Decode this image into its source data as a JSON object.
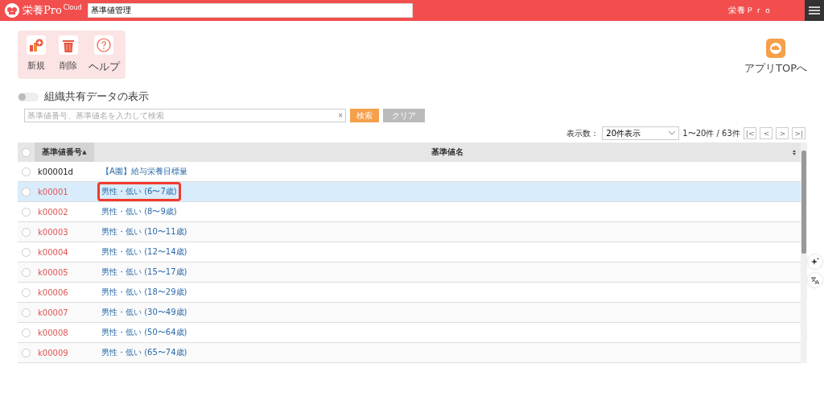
{
  "header": {
    "logo_text": "栄養Pro",
    "logo_badge": "Cloud",
    "page_field": "基準値管理",
    "app_name": "栄養Ｐｒｏ"
  },
  "toolbar": [
    {
      "kind": "new",
      "label": "新規"
    },
    {
      "kind": "delete",
      "label": "削除"
    },
    {
      "kind": "help",
      "label": "ヘルプ"
    }
  ],
  "app_top": {
    "label": "アプリTOPへ"
  },
  "shared_toggle": {
    "label": "組織共有データの表示",
    "on": false
  },
  "search": {
    "placeholder": "基準値番号、基準値名を入力して検索",
    "clear_glyph": "×",
    "search_button": "検索",
    "clear_button": "クリア"
  },
  "pagination": {
    "label": "表示数：",
    "page_size": "20件表示",
    "range": "1〜20件 / 63件",
    "buttons": [
      "|<",
      "<",
      ">",
      ">|"
    ]
  },
  "table": {
    "select_all_checked": false,
    "columns": [
      {
        "label": "基準値番号",
        "sort_glyph": "▲",
        "selected": true
      },
      {
        "label": "基準値名",
        "selected": false
      }
    ],
    "rows": [
      {
        "code": "k00001d",
        "name": "【A園】給与栄養目標量",
        "color": "#222222",
        "selected": false,
        "outlined": false
      },
      {
        "code": "k00001",
        "name": "男性・低い (6〜7歳)",
        "color": "#e05555",
        "selected": true,
        "outlined": true
      },
      {
        "code": "k00002",
        "name": "男性・低い (8〜9歳)",
        "color": "#e05555",
        "selected": false,
        "outlined": false
      },
      {
        "code": "k00003",
        "name": "男性・低い (10〜11歳)",
        "color": "#e05555",
        "selected": false,
        "outlined": false
      },
      {
        "code": "k00004",
        "name": "男性・低い (12〜14歳)",
        "color": "#e05555",
        "selected": false,
        "outlined": false
      },
      {
        "code": "k00005",
        "name": "男性・低い (15〜17歳)",
        "color": "#e05555",
        "selected": false,
        "outlined": false
      },
      {
        "code": "k00006",
        "name": "男性・低い (18〜29歳)",
        "color": "#e05555",
        "selected": false,
        "outlined": false
      },
      {
        "code": "k00007",
        "name": "男性・低い (30〜49歳)",
        "color": "#e05555",
        "selected": false,
        "outlined": false
      },
      {
        "code": "k00008",
        "name": "男性・低い (50〜64歳)",
        "color": "#e05555",
        "selected": false,
        "outlined": false
      },
      {
        "code": "k00009",
        "name": "男性・低い (65〜74歳)",
        "color": "#e05555",
        "selected": false,
        "outlined": false
      }
    ]
  }
}
